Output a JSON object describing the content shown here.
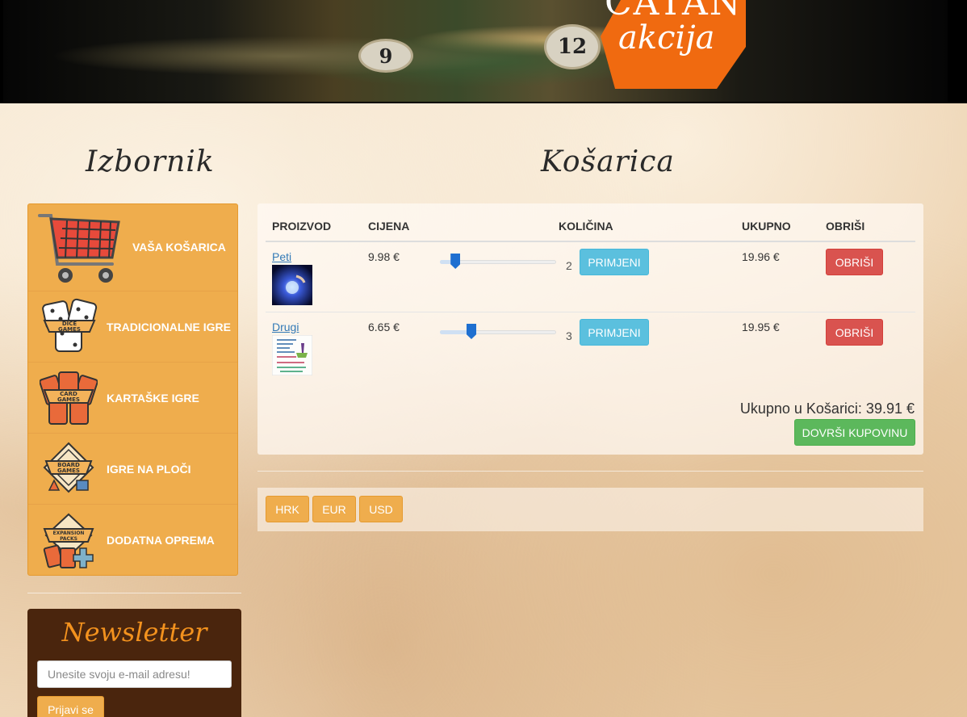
{
  "banner": {
    "title_line1": "CATAN",
    "title_line2": "akcija",
    "token_a": "9",
    "token_b": "12"
  },
  "sidebar": {
    "heading": "Izbornik",
    "items": [
      {
        "label": "VAŠA KOŠARICA",
        "icon": "shopping-cart-icon"
      },
      {
        "label": "TRADICIONALNE IGRE",
        "icon": "dice-games-icon",
        "icon_text": "DICE GAMES"
      },
      {
        "label": "KARTAŠKE IGRE",
        "icon": "card-games-icon",
        "icon_text": "CARD GAMES"
      },
      {
        "label": "IGRE NA PLOČI",
        "icon": "board-games-icon",
        "icon_text": "BOARD GAMES"
      },
      {
        "label": "DODATNA OPREMA",
        "icon": "expansion-packs-icon",
        "icon_text": "EXPANSION PACKS"
      }
    ]
  },
  "newsletter": {
    "title": "Newsletter",
    "email_placeholder": "Unesite svoju e-mail adresu!",
    "submit_label": "Prijavi se"
  },
  "cart": {
    "heading": "Košarica",
    "columns": {
      "product": "PROIZVOD",
      "price": "CIJENA",
      "quantity": "KOLIČINA",
      "total": "UKUPNO",
      "delete": "OBRIŠI"
    },
    "rows": [
      {
        "name": "Peti",
        "price": "9.98 €",
        "quantity": "2",
        "quantity_fraction": 0.1,
        "total": "19.96 €",
        "apply_label": "PRIMJENI",
        "delete_label": "OBRIŠI"
      },
      {
        "name": "Drugi",
        "price": "6.65 €",
        "quantity": "3",
        "quantity_fraction": 0.25,
        "total": "19.95 €",
        "apply_label": "PRIMJENI",
        "delete_label": "OBRIŠI"
      }
    ],
    "cart_total": "Ukupno u Košarici: 39.91 €",
    "checkout_label": "DOVRŠI KUPOVINU"
  },
  "currencies": [
    "HRK",
    "EUR",
    "USD"
  ],
  "colors": {
    "menu_orange": "#efad4d",
    "newsletter_brown": "#4a250d",
    "info": "#5bc0de",
    "danger": "#d9534f",
    "success": "#5cb85c"
  }
}
